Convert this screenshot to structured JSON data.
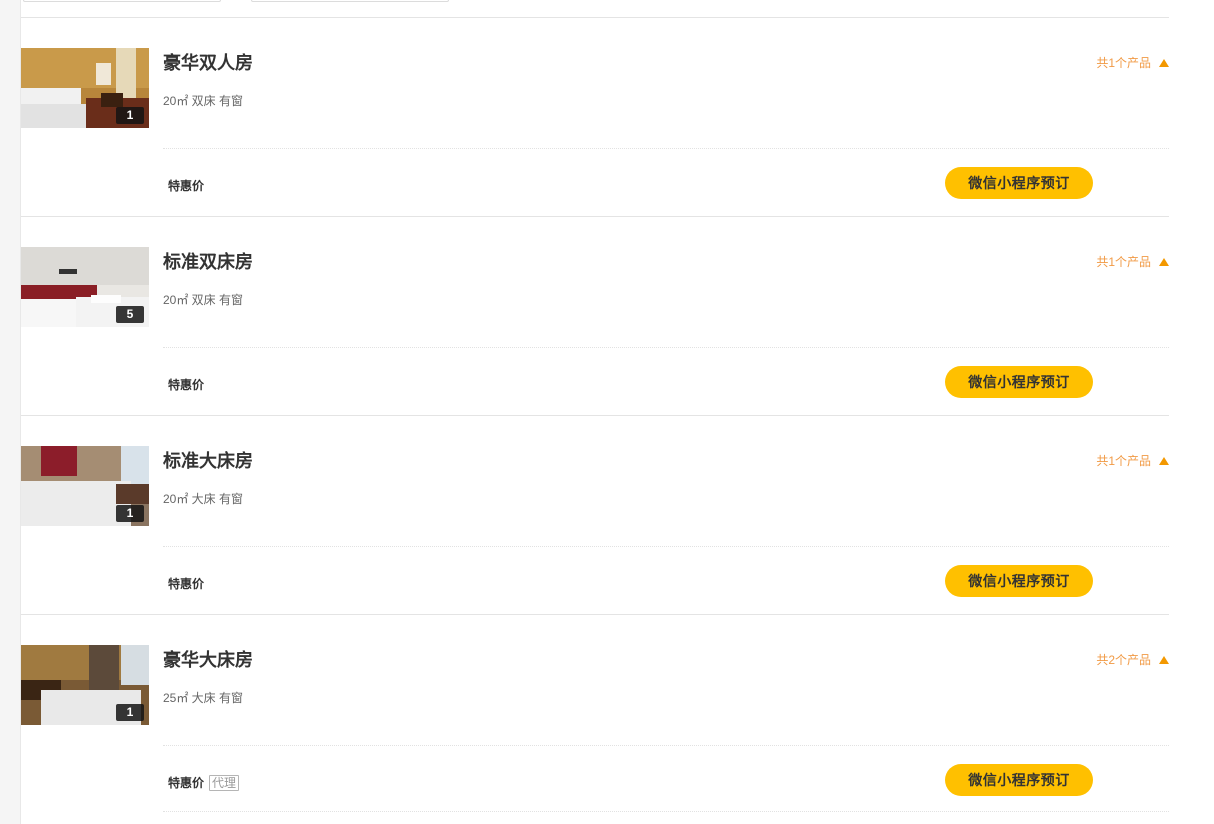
{
  "rooms": [
    {
      "name": "豪华双人房",
      "desc": "20㎡ 双床 有窗",
      "photo_count": "1",
      "product_count": "共1个产品",
      "rate": "特惠价",
      "tag": "",
      "book_label": "微信小程序预订"
    },
    {
      "name": "标准双床房",
      "desc": "20㎡ 双床 有窗",
      "photo_count": "5",
      "product_count": "共1个产品",
      "rate": "特惠价",
      "tag": "",
      "book_label": "微信小程序预订"
    },
    {
      "name": "标准大床房",
      "desc": "20㎡ 大床 有窗",
      "photo_count": "1",
      "product_count": "共1个产品",
      "rate": "特惠价",
      "tag": "",
      "book_label": "微信小程序预订"
    },
    {
      "name": "豪华大床房",
      "desc": "25㎡ 大床 有窗",
      "photo_count": "1",
      "product_count": "共2个产品",
      "rate": "特惠价",
      "tag": "代理",
      "book_label": "微信小程序预订"
    }
  ],
  "colors": {
    "accent": "#f39800",
    "book_button": "#ffc000",
    "product_count_text": "#f19a45"
  },
  "icons": {
    "collapse": "triangle-up-icon"
  }
}
